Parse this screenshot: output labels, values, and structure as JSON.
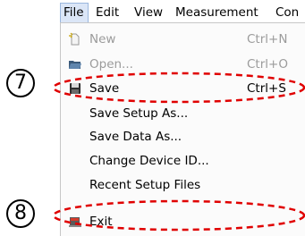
{
  "menubar": {
    "file": "File",
    "edit": "Edit",
    "view": "View",
    "measurement": "Measurement",
    "control": "Con"
  },
  "file_menu": {
    "new": {
      "label": "New",
      "shortcut": "Ctrl+N",
      "enabled": false,
      "icon": "new-document-icon"
    },
    "open": {
      "label": "Open...",
      "shortcut": "Ctrl+O",
      "enabled": false,
      "icon": "open-folder-icon"
    },
    "save": {
      "label": "Save",
      "shortcut": "Ctrl+S",
      "enabled": true,
      "icon": "save-icon"
    },
    "save_setup_as": {
      "label": "Save Setup As..."
    },
    "save_data_as": {
      "label": "Save Data As..."
    },
    "change_device_id": {
      "label": "Change Device ID..."
    },
    "recent_setup_files": {
      "label": "Recent Setup Files"
    },
    "exit": {
      "label": "Exit",
      "icon": "exit-icon"
    }
  },
  "callouts": {
    "save": "7",
    "exit": "8"
  },
  "colors": {
    "annotation": "#e00000",
    "menu_highlight": "#dbe6f7",
    "disabled_text": "#9b9b9b"
  }
}
